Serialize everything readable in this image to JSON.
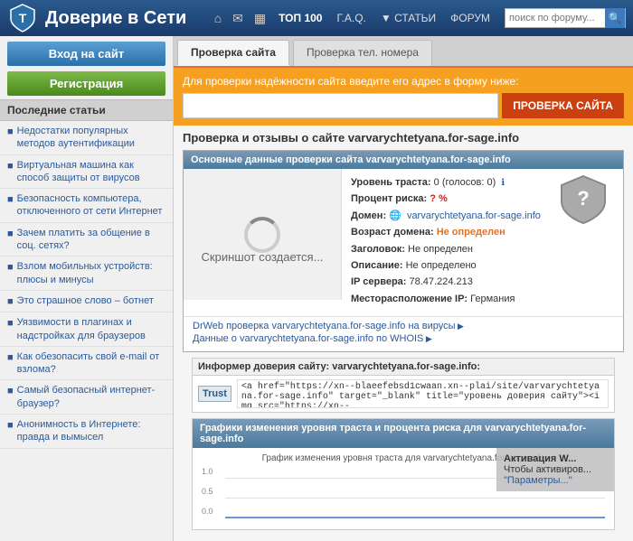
{
  "header": {
    "logo_text": "Доверие в Сети",
    "nav": {
      "home_icon": "⌂",
      "mail_icon": "✉",
      "grid_icon": "▦",
      "top100": "ТОП 100",
      "faq": "Г.А.Q.",
      "articles_dropdown": "▼ СТАТЬИ",
      "forum": "ФОРУМ",
      "search_placeholder": "поиск по форуму..."
    }
  },
  "sidebar": {
    "login_btn": "Вход на сайт",
    "register_btn": "Регистрация",
    "articles_title": "Последние статьи",
    "articles": [
      "Недостатки популярных методов аутентификации",
      "Виртуальная машина как способ защиты от вирусов",
      "Безопасность компьютера, отключенного от сети Интернет",
      "Зачем платить за общение в соц. сетях?",
      "Взлом мобильных устройств: плюсы и минусы",
      "Это страшное слово – ботнет",
      "Уязвимости в плагинах и надстройках для браузеров",
      "Как обезопасить свой e-mail от взлома?",
      "Самый безопасный интернет-браузер?",
      "Анонимность в Интернете: правда и вымысел"
    ]
  },
  "tabs": {
    "check_site": "Проверка сайта",
    "check_phone": "Проверка тел. номера"
  },
  "check_area": {
    "description": "Для проверки надёжности сайта введите его адрес в форму ниже:",
    "url_placeholder": "",
    "check_btn": "ПРОВЕРКА САЙТА"
  },
  "results": {
    "title_prefix": "Проверка и отзывы о сайте ",
    "domain": "varvarychtetyana.for-sage.info",
    "data_panel_header_prefix": "Основные данные проверки сайта ",
    "trust_level_label": "Уровень траста: ",
    "trust_level_value": "0",
    "trust_level_suffix": " (голосов: 0)",
    "percent_risk_label": "Процент риска: ",
    "percent_risk_value": "? %",
    "domain_label": "Домен: ",
    "domain_value": "varvarychtetyana.for-sage.info",
    "domain_age_label": "Возраст домена: ",
    "domain_age_value": "Не определен",
    "header_label": "Заголовок: ",
    "header_value": "Не определен",
    "description_label": "Описание: ",
    "description_value": "Не определено",
    "ip_label": "IP сервера: ",
    "ip_value": "78.47.224.213",
    "location_label": "Месторасположение IP: ",
    "location_value": "Германия",
    "screenshot_text": "Скриншот создается...",
    "drweb_link": "DrWeb проверка varvarychtetyana.for-sage.info на вирусы",
    "whois_link": "Данные о varvarychtetyana.for-sage.info по WHOIS"
  },
  "informer": {
    "title_prefix": "Информер доверия сайту: ",
    "domain": "varvarychtetyana.for-sage.info:",
    "icon_text": "Trust",
    "code_prefix": "<a href=\"https://xn--blaeefebsd1cwaan.xn--plai/site/varvarychtetyana.for-sage.info\" target=\"_blank\" title=\"уровень доверия сайту\"><img src=\"https://xn--"
  },
  "graph": {
    "header": "Графики изменения уровня траста и процента риска для varvarychtetyana.for-sage.info",
    "subtitle": "График изменения уровня траста для varvarychtetyana.for-sage.info",
    "y_labels": [
      "1.0",
      "0.5",
      "0.0"
    ]
  },
  "activation": {
    "title": "Активация W...",
    "text": "Чтобы активиров...",
    "link": "\"Параметры...\""
  }
}
